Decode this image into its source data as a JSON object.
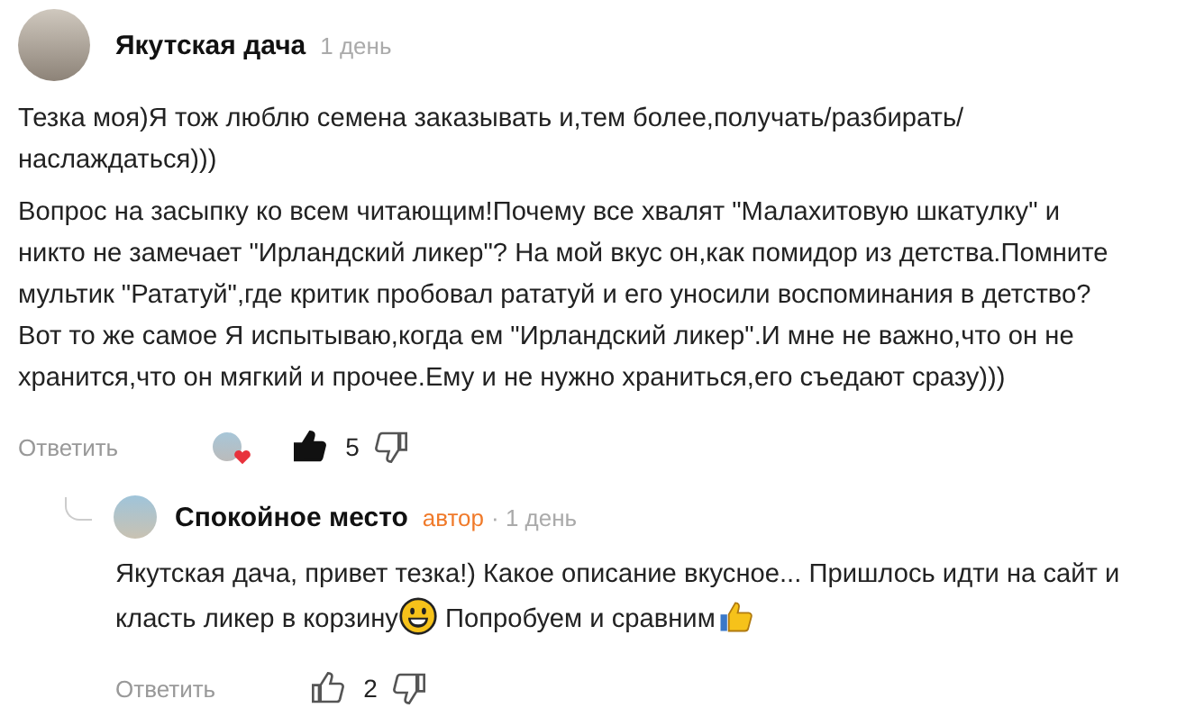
{
  "comments": [
    {
      "author": "Якутская дача",
      "time": "1 день",
      "paragraphs": [
        [
          {
            "kind": "text",
            "text": "Тезка моя)Я тож люблю семена заказывать и,тем более,получать/разбирать/наслаждаться)))"
          }
        ],
        [
          {
            "kind": "text",
            "text": "Вопрос на засыпку ко всем читающим!Почему все хвалят \"Малахитовую шкатулку\" и никто не замечает \"Ирландский ликер\"? На мой вкус он,как помидор из детства.Помните мультик \"Рататуй\",где критик пробовал рататуй и его уносили воспоминания в детство?Вот то же самое Я испытываю,когда ем \"Ирландский ликер\".И мне не важно,что он не хранится,что он мягкий и прочее.Ему и не нужно храниться,его съедают сразу)))"
          }
        ]
      ],
      "reply_label": "Ответить",
      "author_reacted": true,
      "liked": true,
      "likes": "5",
      "replies": [
        {
          "author": "Спокойное место",
          "badge": "автор",
          "time": "· 1 день",
          "paragraphs": [
            [
              {
                "kind": "text",
                "text": "Якутская дача, привет тезка!) Какое описание вкусное... Пришлось идти на сайт и класть ликер в корзину"
              },
              {
                "kind": "smiley"
              },
              {
                "kind": "text",
                "text": " Попробуем и сравним"
              },
              {
                "kind": "thumbsup"
              }
            ]
          ],
          "reply_label": "Ответить",
          "author_reacted": false,
          "liked": false,
          "likes": "2"
        }
      ]
    }
  ]
}
